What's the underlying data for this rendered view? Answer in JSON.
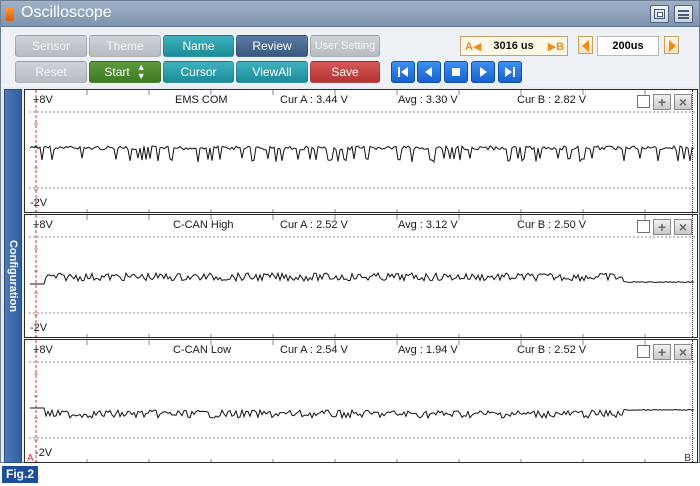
{
  "window": {
    "title": "Oscilloscope"
  },
  "toolbar": {
    "row1": [
      {
        "key": "sensor",
        "label": "Sensor",
        "style": "gray"
      },
      {
        "key": "theme",
        "label": "Theme",
        "style": "gray"
      },
      {
        "key": "name",
        "label": "Name",
        "style": "teal"
      },
      {
        "key": "review",
        "label": "Review",
        "style": "navy"
      },
      {
        "key": "user_setting",
        "label": "User Setting",
        "style": "gray"
      }
    ],
    "row2": [
      {
        "key": "reset",
        "label": "Reset",
        "style": "gray"
      },
      {
        "key": "start",
        "label": "Start",
        "style": "green"
      },
      {
        "key": "cursor",
        "label": "Cursor",
        "style": "teal"
      },
      {
        "key": "view_all",
        "label": "ViewAll",
        "style": "teal"
      },
      {
        "key": "save",
        "label": "Save",
        "style": "red"
      }
    ],
    "cursor_time": {
      "a_label": "A◀",
      "value": "3016 us",
      "b_label": "▶B"
    },
    "time_div": {
      "value": "200us"
    },
    "colors": {
      "accent_orange": "#f08a1c",
      "play_blue": "#1662cf"
    }
  },
  "sidebar": {
    "label": "Configuration"
  },
  "panels": [
    {
      "name": "EMS COM",
      "ymax": "+8V",
      "ymin": "-2V",
      "cur_a": "Cur A : 3.44 V",
      "avg": "Avg : 3.30 V",
      "cur_b": "Cur B : 2.82 V",
      "ylim": [
        -2,
        8
      ]
    },
    {
      "name": "C-CAN High",
      "ymax": "+8V",
      "ymin": "-2V",
      "cur_a": "Cur A : 2.52 V",
      "avg": "Avg : 3.12 V",
      "cur_b": "Cur B : 2.50 V",
      "ylim": [
        -2,
        8
      ]
    },
    {
      "name": "C-CAN Low",
      "ymax": "+8V",
      "ymin": "-2V",
      "cur_a": "Cur A : 2.54 V",
      "avg": "Avg : 1.94 V",
      "cur_b": "Cur B : 2.52 V",
      "ylim": [
        -2,
        8
      ]
    }
  ],
  "markers": {
    "a": "A",
    "b": "B"
  },
  "caption": "Fig.2"
}
